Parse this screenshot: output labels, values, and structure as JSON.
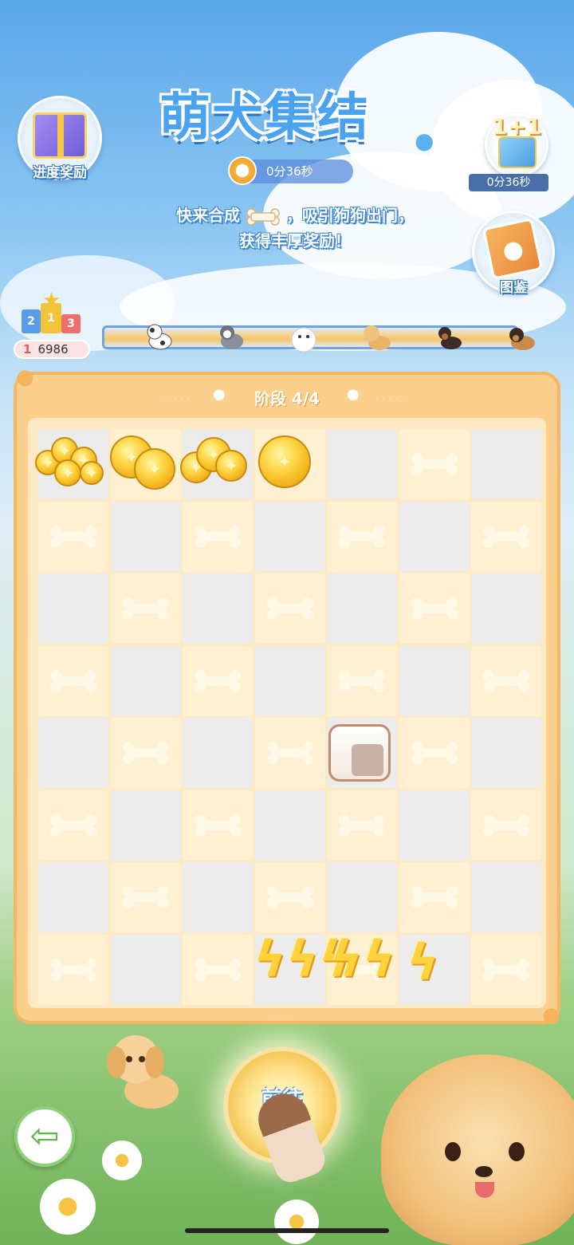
{
  "title": "萌犬集结",
  "timer": {
    "text": "0分36秒"
  },
  "subtitle": {
    "line1_a": "快来合成",
    "line1_b": "，吸引狗狗出门，",
    "line2": "获得丰厚奖励！"
  },
  "left_button": {
    "label": "进度奖励",
    "icon": "gift-icon"
  },
  "right_gift": {
    "badge": "1+1",
    "timer": "0分36秒",
    "icon": "gift-icon"
  },
  "album_button": {
    "label": "图鉴",
    "icon": "paw-book-icon"
  },
  "rank": {
    "position": "1",
    "score": "6986",
    "podium_nums": [
      "2",
      "1",
      "3"
    ]
  },
  "stage": {
    "label": "阶段 4/4"
  },
  "board": {
    "rows": 8,
    "cols": 7,
    "items": [
      {
        "row": 0,
        "col": 0,
        "type": "coin-pile-large"
      },
      {
        "row": 0,
        "col": 1,
        "type": "coin-pair"
      },
      {
        "row": 0,
        "col": 2,
        "type": "coin-stack"
      },
      {
        "row": 0,
        "col": 3,
        "type": "coin-single"
      },
      {
        "row": 4,
        "col": 4,
        "type": "treat-machine"
      },
      {
        "row": 7,
        "col": 3,
        "type": "energy-triple"
      },
      {
        "row": 7,
        "col": 4,
        "type": "energy-double"
      },
      {
        "row": 7,
        "col": 5,
        "type": "energy-single"
      }
    ]
  },
  "go_button": {
    "label_line1": "前往",
    "label_line2": "收集"
  },
  "back_button": {
    "icon": "back-arrow-icon"
  },
  "colors": {
    "board_bg": "#fbd08c",
    "cell_light": "#fff0d2",
    "cell_gray": "#ececec",
    "title_blue": "#4aa3ef"
  }
}
